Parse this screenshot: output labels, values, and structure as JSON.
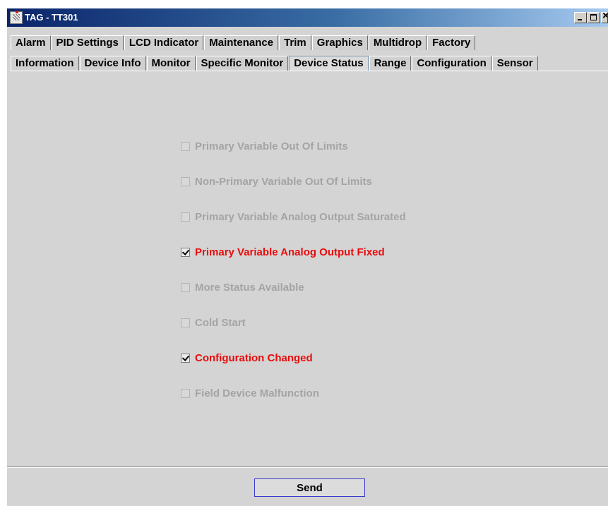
{
  "window": {
    "title": "TAG - TT301"
  },
  "tabs": {
    "row1": [
      "Alarm",
      "PID Settings",
      "LCD Indicator",
      "Maintenance",
      "Trim",
      "Graphics",
      "Multidrop",
      "Factory"
    ],
    "row2": [
      "Information",
      "Device Info",
      "Monitor",
      "Specific Monitor",
      "Device Status",
      "Range",
      "Configuration",
      "Sensor"
    ],
    "selected": "Device Status"
  },
  "status_items": [
    {
      "label": "Primary Variable Out Of Limits",
      "checked": false
    },
    {
      "label": "Non-Primary Variable Out Of Limits",
      "checked": false
    },
    {
      "label": "Primary Variable Analog Output Saturated",
      "checked": false
    },
    {
      "label": "Primary Variable Analog Output Fixed",
      "checked": true
    },
    {
      "label": "More Status Available",
      "checked": false
    },
    {
      "label": "Cold Start",
      "checked": false
    },
    {
      "label": "Configuration Changed",
      "checked": true
    },
    {
      "label": "Field Device Malfunction",
      "checked": false
    }
  ],
  "send_button": {
    "label": "Send"
  },
  "colors": {
    "checked_label": "#e80c0c",
    "disabled_label": "#a4a4a4",
    "titlebar_start": "#0a246a",
    "panel_background": "#d4d4d4"
  },
  "icons": {
    "app": "app-icon",
    "minimize": "minimize-icon",
    "maximize": "maximize-icon",
    "close": "close-icon",
    "check": "checkmark-icon"
  }
}
